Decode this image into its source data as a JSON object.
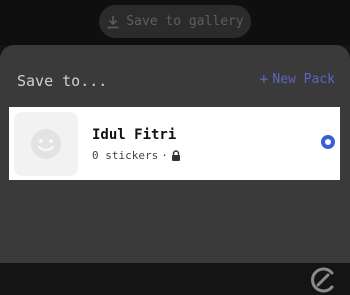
{
  "topbar": {
    "save_to_gallery_label": "Save to gallery",
    "download_icon": "download-icon"
  },
  "sheet": {
    "title": "Save to...",
    "new_pack_plus": "+",
    "new_pack_label": "New Pack",
    "packs": [
      {
        "name": "Idul Fitri",
        "count_label": "0 stickers",
        "separator": "·",
        "lock_icon": "lock-icon",
        "thumbnail_icon": "smiley-icon",
        "selected": true
      }
    ]
  },
  "colors": {
    "accent": "#3d5ed6",
    "new_pack": "#5b66c4",
    "sheet_bg": "#3a3a3a"
  }
}
